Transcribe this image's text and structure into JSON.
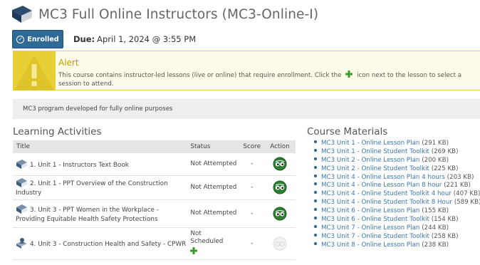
{
  "header": {
    "title": "MC3 Full Online Instructors (MC3-Online-I)",
    "icon": "book-icon"
  },
  "enrollment": {
    "badge_label": "Enrolled",
    "due_label": "Due:",
    "due_value": "April 1, 2024 @ 3:55 PM"
  },
  "alert": {
    "title": "Alert",
    "text_before": "This course contains instructor-led lessons (live or online) that require enrollment. Click the",
    "text_after": "icon next to the lesson to select a session to attend."
  },
  "description": "MC3 program developed for fully online purposes",
  "learning_activities": {
    "title": "Learning Activities",
    "columns": [
      "Title",
      "Status",
      "Score",
      "Action"
    ],
    "rows": [
      {
        "title": "1. Unit 1 - Instructors Text Book",
        "status": "Not Attempted",
        "score": "-",
        "action": "launch-icon"
      },
      {
        "title": "2. Unit 1 - PPT Overview of the Construction Industry",
        "status": "Not Attempted",
        "score": "-",
        "action": "launch-icon"
      },
      {
        "title": "3. Unit 3 - PPT Women in the Workplace - Providing Equitable Health Safety Protections",
        "status": "Not Attempted",
        "score": "-",
        "action": "launch-icon"
      },
      {
        "title": "4. Unit 3 - Construction Health and Safety - CPWR",
        "status": "Not Scheduled",
        "score": "-",
        "action": "launch-disabled-icon"
      }
    ]
  },
  "course_materials": {
    "title": "Course Materials",
    "items": [
      {
        "name": "MC3 Unit 1 - Online Lesson Plan",
        "size": "(291 KB)"
      },
      {
        "name": "MC3 Unit 1 - Online Student Toolkit",
        "size": "(269 KB)"
      },
      {
        "name": "MC3 Unit 2 - Online Lesson Plan",
        "size": "(200 KB)"
      },
      {
        "name": "MC3 Unit 2 - Online Student Toolkit",
        "size": "(225 KB)"
      },
      {
        "name": "MC3 Unit 4 - Online Lesson Plan 4 hours",
        "size": "(203 KB)"
      },
      {
        "name": "MC3 Unit 4 - Online Lesson Plan 8 hour",
        "size": "(221 KB)"
      },
      {
        "name": "MC3 Unit 4 - Online Student Toolkit 4 hour",
        "size": "(407 KB)"
      },
      {
        "name": "MC3 Unit 4 - Online Student Toolkit 8 Hour",
        "size": "(589 KB)"
      },
      {
        "name": "MC3 Unit 6 - Online Lesson Plan",
        "size": "(155 KB)"
      },
      {
        "name": "MC3 Unit 6 - Online Student Toolkit",
        "size": "(154 KB)"
      },
      {
        "name": "MC3 Unit 7 - Online Lesson Plan",
        "size": "(244 KB)"
      },
      {
        "name": "MC3 Unit 7 - Online Student Toolkit",
        "size": "(258 KB)"
      },
      {
        "name": "MC3 Unit 8 - Online Lesson Plan",
        "size": "(238 KB)"
      }
    ]
  },
  "colors": {
    "badge": "#2f6a96",
    "alert_accent": "#e8cf36",
    "link": "#3a77b0",
    "plus": "#3f9a2c"
  }
}
